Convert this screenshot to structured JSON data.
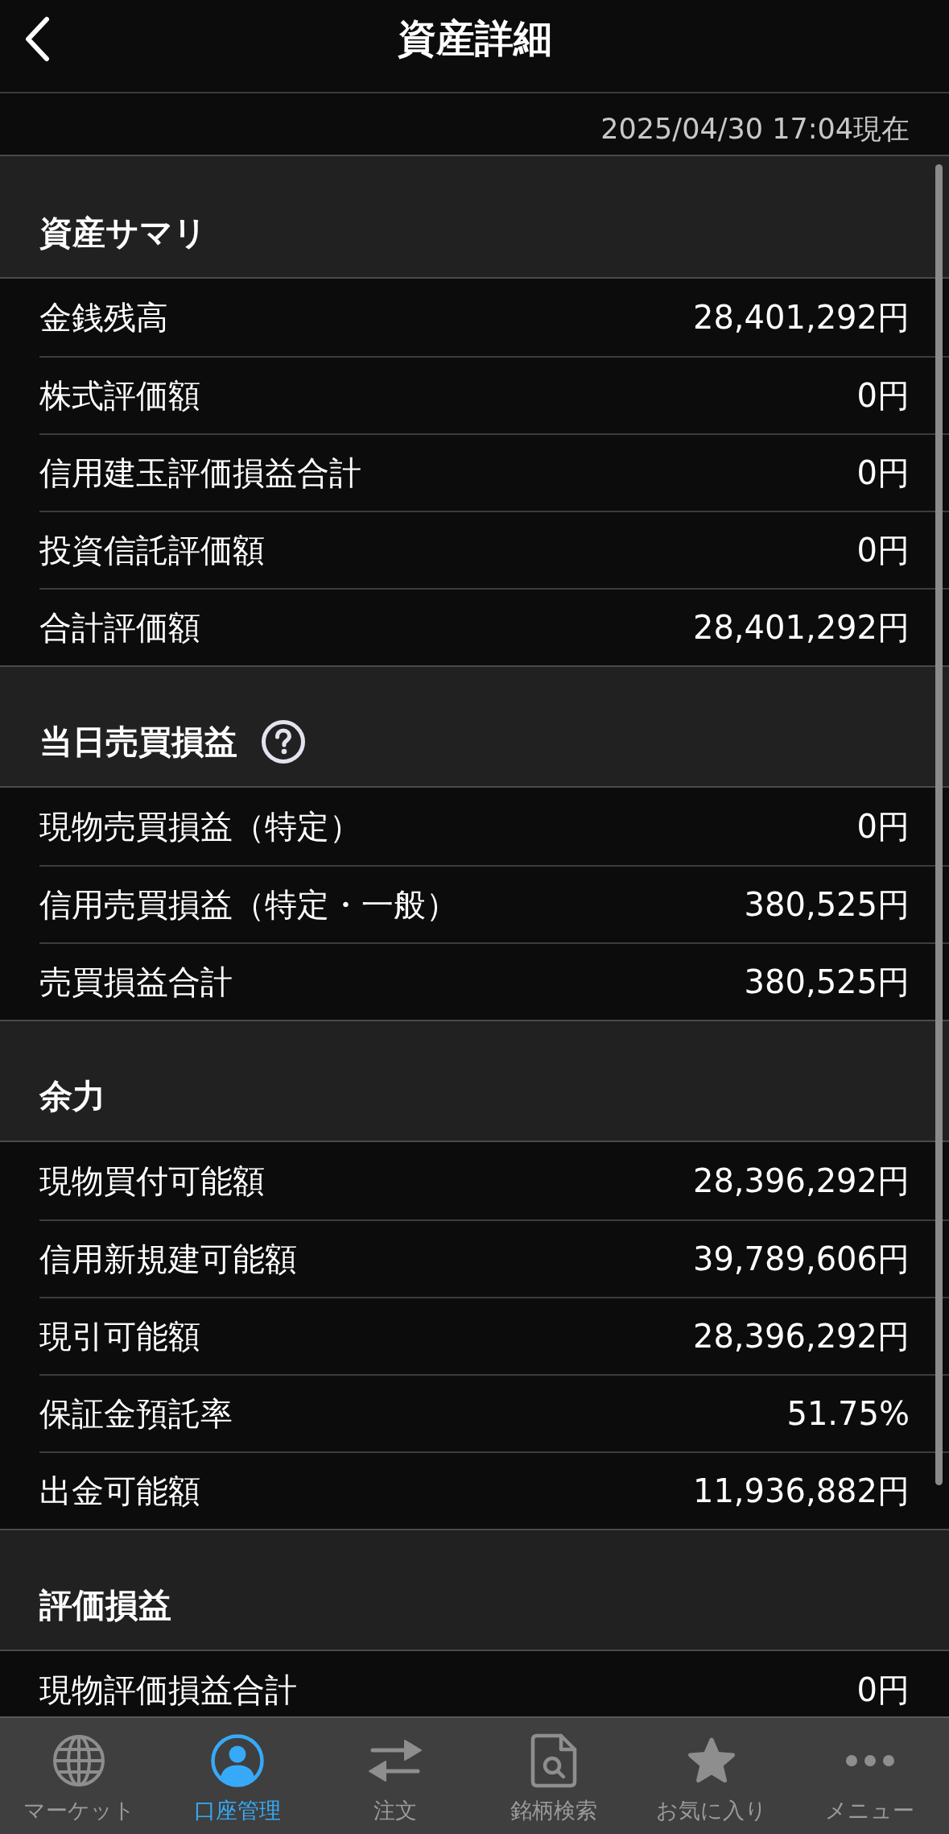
{
  "header": {
    "title": "資産詳細"
  },
  "timestamp": "2025/04/30 17:04現在",
  "sections": [
    {
      "title": "資産サマリ",
      "help": false,
      "rows": [
        {
          "label": "金銭残高",
          "value": "28,401,292円"
        },
        {
          "label": "株式評価額",
          "value": "0円"
        },
        {
          "label": "信用建玉評価損益合計",
          "value": "0円"
        },
        {
          "label": "投資信託評価額",
          "value": "0円"
        },
        {
          "label": "合計評価額",
          "value": "28,401,292円"
        }
      ]
    },
    {
      "title": "当日売買損益",
      "help": true,
      "rows": [
        {
          "label": "現物売買損益（特定）",
          "value": "0円"
        },
        {
          "label": "信用売買損益（特定・一般）",
          "value": "380,525円"
        },
        {
          "label": "売買損益合計",
          "value": "380,525円"
        }
      ]
    },
    {
      "title": "余力",
      "help": false,
      "rows": [
        {
          "label": "現物買付可能額",
          "value": "28,396,292円"
        },
        {
          "label": "信用新規建可能額",
          "value": "39,789,606円"
        },
        {
          "label": "現引可能額",
          "value": "28,396,292円"
        },
        {
          "label": "保証金預託率",
          "value": "51.75%"
        },
        {
          "label": "出金可能額",
          "value": "11,936,882円"
        }
      ]
    },
    {
      "title": "評価損益",
      "help": false,
      "rows": [
        {
          "label": "現物評価損益合計",
          "value": "0円"
        }
      ]
    }
  ],
  "tab_bar": [
    {
      "label": "マーケット",
      "selected": false
    },
    {
      "label": "口座管理",
      "selected": true
    },
    {
      "label": "注文",
      "selected": false
    },
    {
      "label": "銘柄検索",
      "selected": false
    },
    {
      "label": "お気に入り",
      "selected": false
    },
    {
      "label": "メニュー",
      "selected": false
    }
  ]
}
